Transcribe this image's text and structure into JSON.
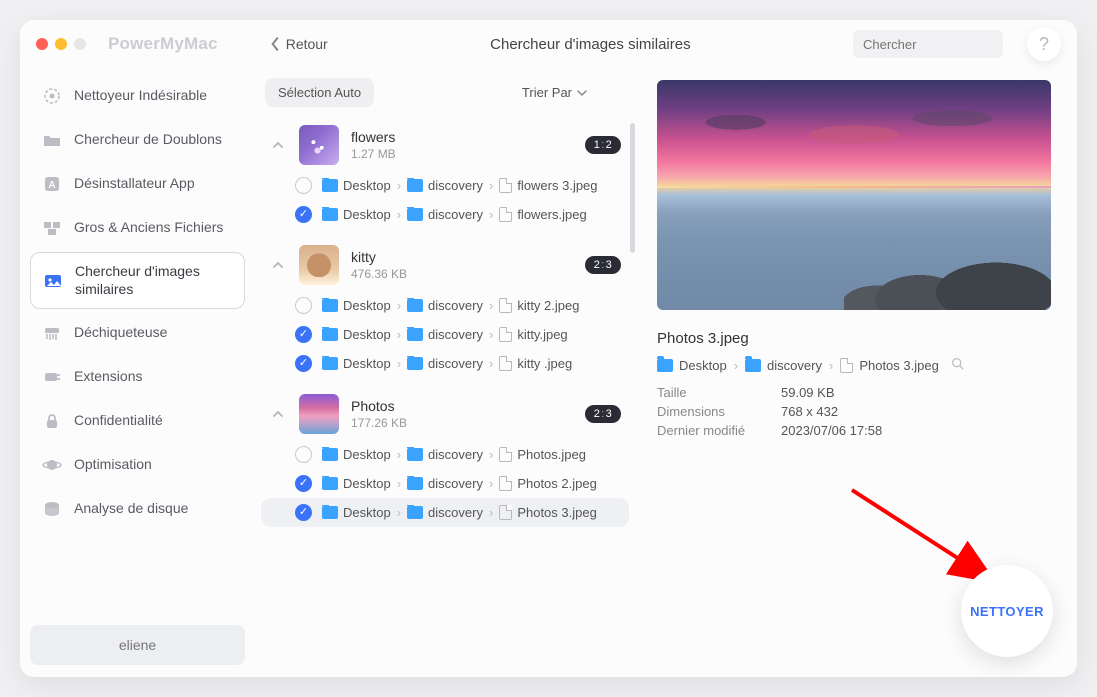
{
  "app": {
    "name": "PowerMyMac",
    "back": "Retour",
    "title": "Chercheur d'images similaires"
  },
  "search": {
    "placeholder": "Chercher"
  },
  "help": {
    "glyph": "?"
  },
  "sidebar": {
    "items": [
      {
        "label": "Nettoyeur Indésirable"
      },
      {
        "label": "Chercheur de Doublons"
      },
      {
        "label": "Désinstallateur App"
      },
      {
        "label": "Gros & Anciens Fichiers"
      },
      {
        "label": "Chercheur d'images similaires"
      },
      {
        "label": "Déchiqueteuse"
      },
      {
        "label": "Extensions"
      },
      {
        "label": "Confidentialité"
      },
      {
        "label": "Optimisation"
      },
      {
        "label": "Analyse de disque"
      }
    ],
    "user": "eliene"
  },
  "toolbar": {
    "auto_select": "Sélection Auto",
    "sort": "Trier Par"
  },
  "path_labels": {
    "desktop": "Desktop",
    "discovery": "discovery"
  },
  "groups": [
    {
      "name": "flowers",
      "size": "1.27 MB",
      "badge_a": "1",
      "badge_b": "2",
      "rows": [
        {
          "sel": false,
          "file": "flowers 3.jpeg"
        },
        {
          "sel": true,
          "file": "flowers.jpeg"
        }
      ]
    },
    {
      "name": "kitty",
      "size": "476.36 KB",
      "badge_a": "2",
      "badge_b": "3",
      "rows": [
        {
          "sel": false,
          "file": "kitty 2.jpeg"
        },
        {
          "sel": true,
          "file": "kitty.jpeg"
        },
        {
          "sel": true,
          "file": "kitty .jpeg"
        }
      ]
    },
    {
      "name": "Photos",
      "size": "177.26 KB",
      "badge_a": "2",
      "badge_b": "3",
      "rows": [
        {
          "sel": false,
          "file": "Photos.jpeg"
        },
        {
          "sel": true,
          "file": "Photos 2.jpeg"
        },
        {
          "sel": true,
          "file": "Photos 3.jpeg",
          "hl": true
        }
      ]
    }
  ],
  "detail": {
    "filename": "Photos 3.jpeg",
    "path_file": "Photos 3.jpeg",
    "size_label": "Taille",
    "size_value": "59.09 KB",
    "dim_label": "Dimensions",
    "dim_value": "768 x 432",
    "mod_label": "Dernier modifié",
    "mod_value": "2023/07/06 17:58"
  },
  "clean": {
    "label": "NETTOYER"
  }
}
